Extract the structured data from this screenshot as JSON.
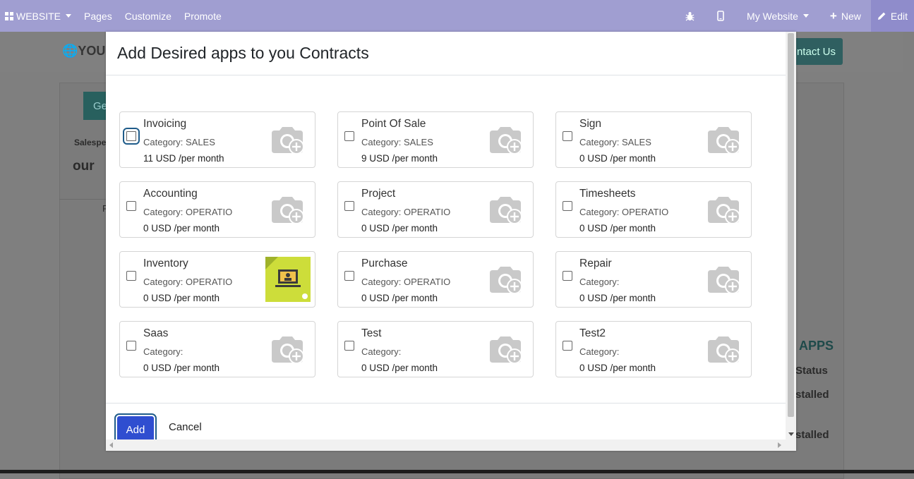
{
  "topbar": {
    "website_label": "WEBSITE",
    "pages_label": "Pages",
    "customize_label": "Customize",
    "promote_label": "Promote",
    "site_selector": "My Website",
    "new_label": "New",
    "edit_label": "Edit"
  },
  "background": {
    "logo_text": "YOUR",
    "contact_button": "ntact Us",
    "green_button": "Ge",
    "salesperson_label": "Salespe",
    "title_fragment": "our",
    "apps_heading": "APPS",
    "status_header": "Status",
    "status_1": "stalled",
    "status_2": "stalled",
    "row_fragment": "F"
  },
  "modal": {
    "title": "Add Desired apps to you Contracts",
    "add_label": "Add",
    "cancel_label": "Cancel",
    "apps": [
      {
        "name": "Invoicing",
        "category": "Category: SALES",
        "price": "11 USD /per month",
        "image": "camera-plus",
        "focused": true
      },
      {
        "name": "Point Of Sale",
        "category": "Category: SALES",
        "price": "9 USD /per month",
        "image": "camera-plus"
      },
      {
        "name": "Sign",
        "category": "Category: SALES",
        "price": "0 USD /per month",
        "image": "camera-plus"
      },
      {
        "name": "Accounting",
        "category": "Category: OPERATIO",
        "price": "0 USD /per month",
        "image": "camera-plus"
      },
      {
        "name": "Project",
        "category": "Category: OPERATIO",
        "price": "0 USD /per month",
        "image": "camera-plus"
      },
      {
        "name": "Timesheets",
        "category": "Category: OPERATIO",
        "price": "0 USD /per month",
        "image": "camera-plus"
      },
      {
        "name": "Inventory",
        "category": "Category: OPERATIO",
        "price": "0 USD /per month",
        "image": "app-thumbnail"
      },
      {
        "name": "Purchase",
        "category": "Category: OPERATIO",
        "price": "0 USD /per month",
        "image": "camera-plus"
      },
      {
        "name": "Repair",
        "category": "Category:",
        "price": "0 USD /per month",
        "image": "camera-plus"
      },
      {
        "name": "Saas",
        "category": "Category:",
        "price": "0 USD /per month",
        "image": "camera-plus"
      },
      {
        "name": "Test",
        "category": "Category:",
        "price": "0 USD /per month",
        "image": "camera-plus"
      },
      {
        "name": "Test2",
        "category": "Category:",
        "price": "0 USD /per month",
        "image": "camera-plus"
      }
    ]
  },
  "colors": {
    "topbar": "#a09ed1",
    "add_button": "#2f4ed0",
    "inventory_thumbnail": "#cddd3a"
  }
}
